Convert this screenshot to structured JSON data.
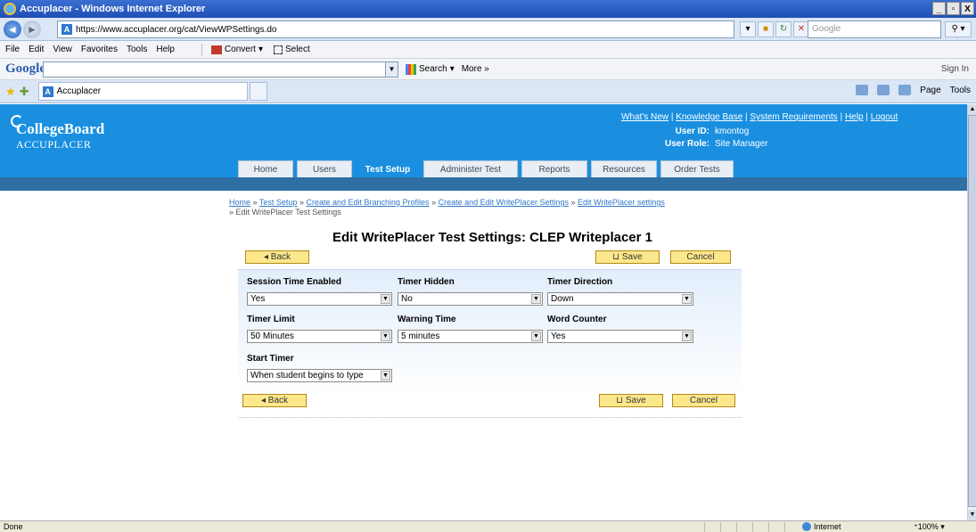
{
  "window": {
    "title": "Accuplacer - Windows Internet Explorer",
    "controls": [
      "_",
      "▫",
      "X"
    ]
  },
  "addressbar": {
    "url": "https://www.accuplacer.org/cat/ViewWPSettings.do",
    "search_placeholder": "Google"
  },
  "menubar": {
    "items": [
      "File",
      "Edit",
      "View",
      "Favorites",
      "Tools",
      "Help"
    ],
    "convert_label": "Convert",
    "select_label": "Select"
  },
  "googlebar": {
    "logo": "Google",
    "search_label": "Search",
    "more_label": "More »",
    "signin_label": "Sign In"
  },
  "browser_tab": {
    "label": "Accuplacer"
  },
  "commandbar": {
    "page_label": "Page",
    "tools_label": "Tools"
  },
  "header": {
    "logo_line1": "CollegeBoard",
    "logo_line2": "ACCUPLACER",
    "toplinks": [
      "What's New",
      "Knowledge Base",
      "System Requirements",
      "Help",
      "Logout"
    ],
    "user_id_label": "User ID:",
    "user_id": "kmontog",
    "user_role_label": "User Role:",
    "user_role": "Site Manager"
  },
  "nav": {
    "tabs": [
      {
        "label": "Home",
        "active": false
      },
      {
        "label": "Users",
        "active": false
      },
      {
        "label": "Test Setup",
        "active": true
      },
      {
        "label": "Administer Test",
        "active": false
      },
      {
        "label": "Reports",
        "active": false
      },
      {
        "label": "Resources",
        "active": false
      },
      {
        "label": "Order Tests",
        "active": false
      }
    ]
  },
  "breadcrumb": {
    "links": [
      "Home",
      "Test Setup",
      "Create and Edit Branching Profiles",
      "Create and Edit WritePlacer Settings",
      "Edit WritePlacer settings"
    ],
    "current": "Edit WritePlacer Test Settings",
    "separator": "»"
  },
  "page_title": "Edit WritePlacer Test Settings: CLEP Writeplacer 1",
  "buttons": {
    "back": "Back",
    "save": "Save",
    "cancel": "Cancel"
  },
  "form": {
    "session_time_enabled": {
      "label": "Session Time Enabled",
      "value": "Yes"
    },
    "timer_hidden": {
      "label": "Timer Hidden",
      "value": "No"
    },
    "timer_direction": {
      "label": "Timer Direction",
      "value": "Down"
    },
    "timer_limit": {
      "label": "Timer Limit",
      "value": "50 Minutes"
    },
    "warning_time": {
      "label": "Warning Time",
      "value": "5 minutes"
    },
    "word_counter": {
      "label": "Word Counter",
      "value": "Yes"
    },
    "start_timer": {
      "label": "Start Timer",
      "value": "When student begins to type"
    }
  },
  "statusbar": {
    "status": "Done",
    "zone": "Internet",
    "zoom": "100%"
  },
  "colors": {
    "header_blue": "#1a8fe0",
    "band_blue": "#2f6fa4",
    "button_yellow": "#fde78c"
  }
}
